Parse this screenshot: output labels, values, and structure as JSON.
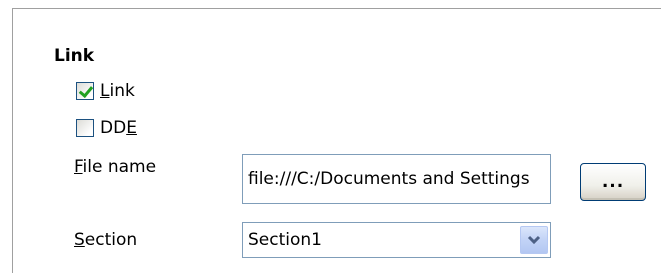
{
  "link_section": {
    "title": "Link",
    "link_checkbox": {
      "label_mnemonic": "L",
      "label_rest": "ink",
      "checked": true
    },
    "dde_checkbox": {
      "label_prefix": "DD",
      "label_mnemonic": "E",
      "checked": false
    }
  },
  "file_name": {
    "label_mnemonic": "F",
    "label_rest": "ile name",
    "value": "file:///C:/Documents and Settings",
    "browse_label": "..."
  },
  "section": {
    "label_mnemonic": "S",
    "label_rest": "ection",
    "value": "Section1",
    "arrow_icon": "chevron-down-icon"
  },
  "colors": {
    "checkmark": "#21a121",
    "input_border": "#7f9db9",
    "button_border": "#003c74"
  }
}
